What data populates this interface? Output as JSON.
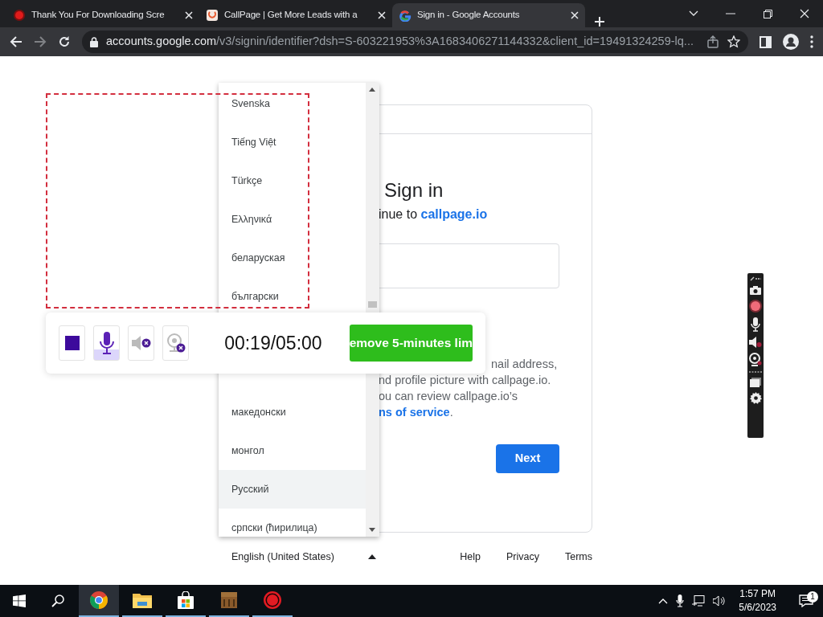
{
  "browser": {
    "tabs": [
      {
        "title": "Thank You For Downloading Scre",
        "selected": false
      },
      {
        "title": "CallPage | Get More Leads with a",
        "selected": false
      },
      {
        "title": "Sign in - Google Accounts",
        "selected": true
      }
    ],
    "address": {
      "host": "accounts.google.com",
      "path": "/v3/signin/identifier?dsh=S-603221953%3A1683406271144332&client_id=19491324259-lq..."
    }
  },
  "signin": {
    "title": "Sign in",
    "subtitle": "inue to ",
    "subtitle_link": "callpage.io",
    "body_lines": [
      "nail address,",
      "nd profile picture with callpage.io.",
      "ou can review callpage.io’s"
    ],
    "terms_link": "ns of service",
    "terms_suffix": ".",
    "next": "Next"
  },
  "language_menu": {
    "items": [
      {
        "label": "Svenska",
        "hovered": false
      },
      {
        "label": "Tiếng Việt",
        "hovered": false
      },
      {
        "label": "Türkçe",
        "hovered": false
      },
      {
        "label": "Ελληνικά",
        "hovered": false
      },
      {
        "label": "беларуская",
        "hovered": false
      },
      {
        "label": "български",
        "hovered": false
      },
      {
        "label": "македонски",
        "hovered": false
      },
      {
        "label": "монгол",
        "hovered": false
      },
      {
        "label": "Русский",
        "hovered": true
      },
      {
        "label": "српски (ћирилица)",
        "hovered": false
      }
    ]
  },
  "footer": {
    "language": "English (United States)",
    "expanded": true,
    "links": [
      "Help",
      "Privacy",
      "Terms"
    ]
  },
  "recorder": {
    "controls": [
      {
        "kind": "stop",
        "selected": false
      },
      {
        "kind": "mic",
        "selected": true
      },
      {
        "kind": "speaker",
        "selected": false
      },
      {
        "kind": "webcam",
        "selected": false
      }
    ],
    "timer": "00:19/05:00",
    "upgrade": "emove 5-minutes lim"
  },
  "taskbar": {
    "apps": [
      {
        "selected": true
      },
      {
        "selected": false
      },
      {
        "selected": false
      },
      {
        "selected": false
      },
      {
        "selected": false
      }
    ],
    "time": "1:57 PM",
    "date": "5/6/2023",
    "notifications": "1"
  }
}
